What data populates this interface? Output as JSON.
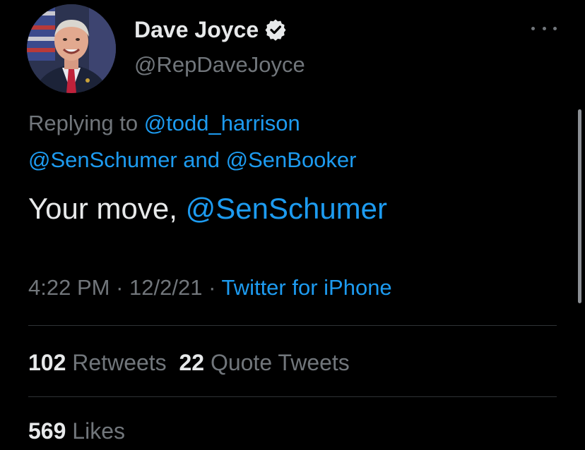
{
  "author": {
    "display_name": "Dave Joyce",
    "handle": "@RepDaveJoyce",
    "verified_icon": "verified-badge-icon",
    "avatar_icon": "profile-photo"
  },
  "more_icon": "more-options-icon",
  "reply_context": {
    "prefix": "Replying to ",
    "mention_1": "@todd_harrison",
    "mention_2": "@SenSchumer",
    "conjunction": " and ",
    "mention_3": "@SenBooker"
  },
  "tweet": {
    "text": "Your move, ",
    "mention": "@SenSchumer"
  },
  "meta": {
    "time": "4:22 PM",
    "separator": " · ",
    "date": "12/2/21",
    "source": "Twitter for iPhone"
  },
  "stats": {
    "retweets_count": "102",
    "retweets_label": "Retweets",
    "quotes_count": "22",
    "quotes_label": "Quote Tweets",
    "likes_count": "569",
    "likes_label": "Likes"
  },
  "colors": {
    "background": "#000000",
    "text": "#e7e9ea",
    "secondary": "#71767b",
    "link": "#1d9bf0",
    "divider": "#2f3336"
  }
}
